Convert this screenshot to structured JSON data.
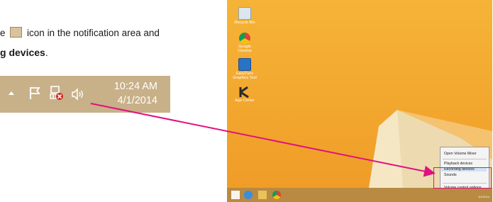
{
  "instructions": {
    "line1_before": "e",
    "line1_after": "icon in the notification area and",
    "line2_bold": "g devices",
    "line2_punct": "."
  },
  "tray": {
    "time": "10:24 AM",
    "date": "4/1/2014",
    "icons": [
      "caret-up-icon",
      "flag-icon",
      "network-error-icon",
      "speaker-icon"
    ]
  },
  "desktop": {
    "icons": [
      {
        "label": "Recycle Bin"
      },
      {
        "label": "Google Chrome"
      },
      {
        "label": "EasyTune Graphics Tool"
      },
      {
        "label": "App Center"
      }
    ],
    "context_menu": {
      "items": [
        "Open Volume Mixer",
        "Playback devices",
        "Recording devices",
        "Sounds",
        "Volume control options"
      ],
      "selected": "Recording devices"
    },
    "taskbar_clock": "4/1/2014"
  },
  "colors": {
    "accent_arrow": "#e0117f",
    "desktop_bg": "#f2a52d",
    "tray_bg": "#c8b088"
  }
}
